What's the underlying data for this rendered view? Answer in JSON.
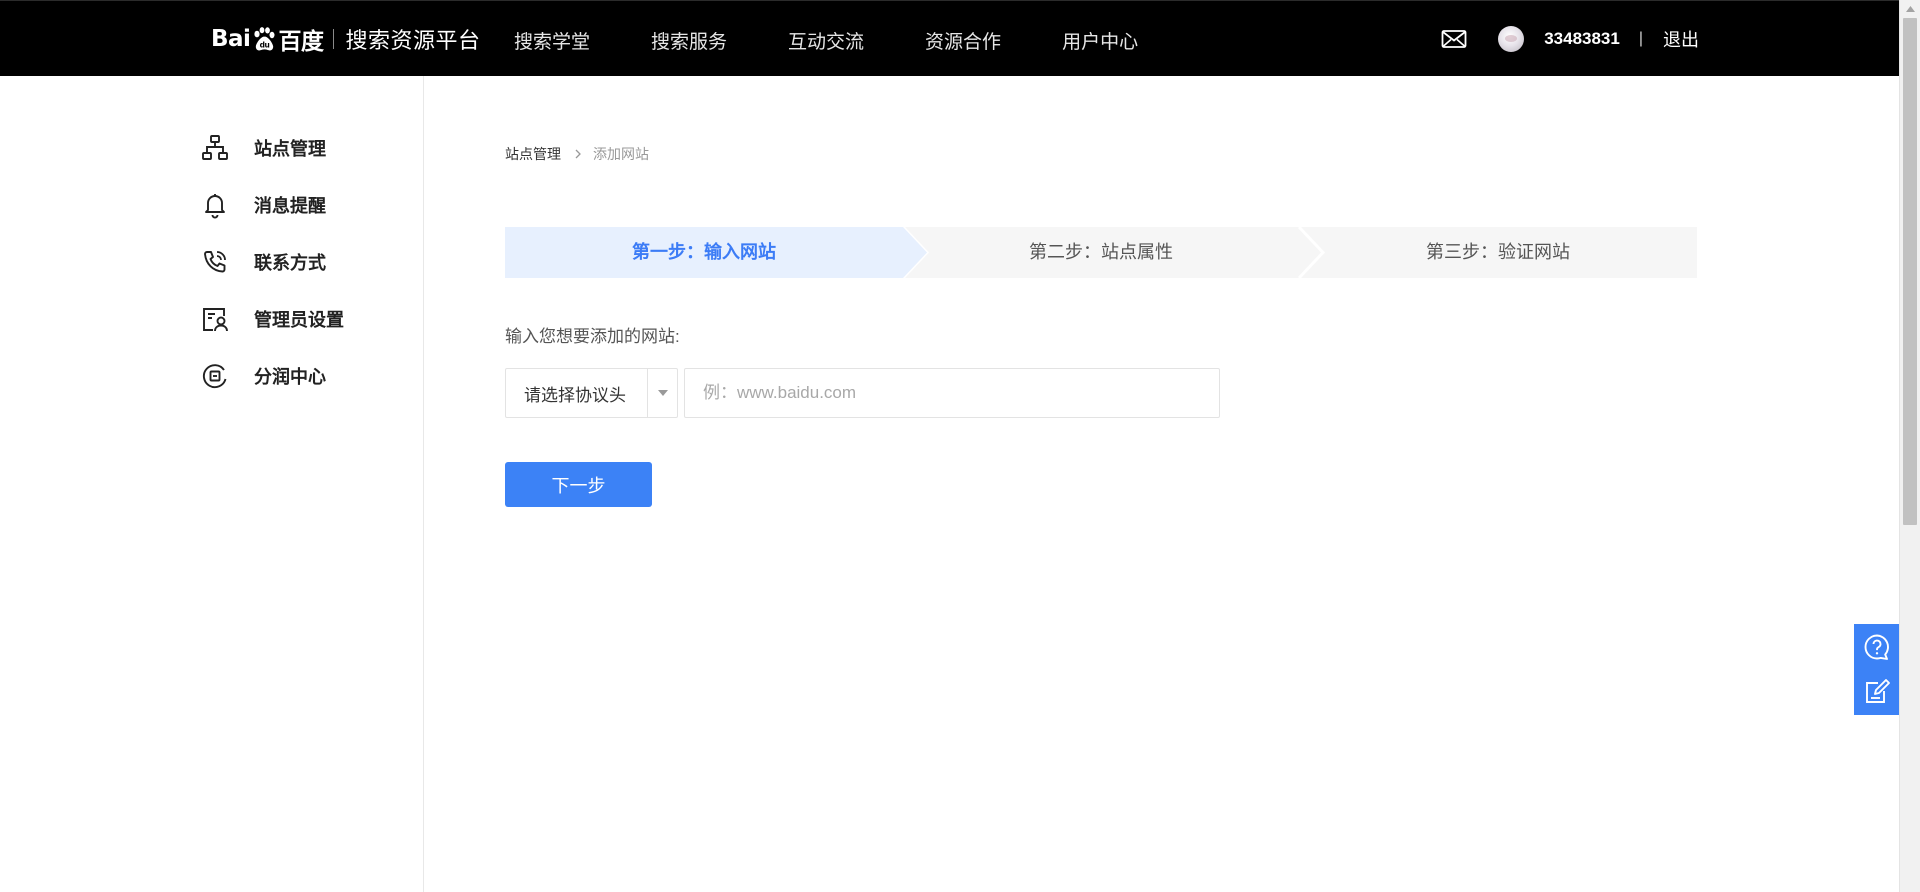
{
  "header": {
    "brand_logo": "Bai百度",
    "platform_title": "搜索资源平台",
    "nav": [
      "搜索学堂",
      "搜索服务",
      "互动交流",
      "资源合作",
      "用户中心"
    ],
    "mail_icon": "mail-icon",
    "username": "33483831",
    "divider": "|",
    "logout": "退出"
  },
  "sidebar": {
    "items": [
      {
        "label": "站点管理",
        "icon": "sitemap-icon"
      },
      {
        "label": "消息提醒",
        "icon": "bell-icon"
      },
      {
        "label": "联系方式",
        "icon": "phone-icon"
      },
      {
        "label": "管理员设置",
        "icon": "admin-card-icon"
      },
      {
        "label": "分润中心",
        "icon": "revenue-icon"
      }
    ]
  },
  "breadcrumb": {
    "parent": "站点管理",
    "separator_icon": "chevron-right-icon",
    "current": "添加网站"
  },
  "steps": {
    "active_index": 0,
    "items": [
      "第一步：输入网站",
      "第二步：站点属性",
      "第三步：验证网站"
    ]
  },
  "form": {
    "label": "输入您想要添加的网站:",
    "protocol_select": {
      "value": "请选择协议头",
      "icon": "caret-down-icon"
    },
    "url_input": {
      "value": "",
      "placeholder": "例：www.baidu.com"
    },
    "submit_label": "下一步"
  },
  "float_tools": {
    "help_icon": "question-bubble-icon",
    "feedback_icon": "edit-note-icon"
  },
  "colors": {
    "topbar": "#000000",
    "primary": "#3c82f6",
    "active_step_bg": "#e7f0fe",
    "inactive_step_bg": "#f6f6f6"
  }
}
